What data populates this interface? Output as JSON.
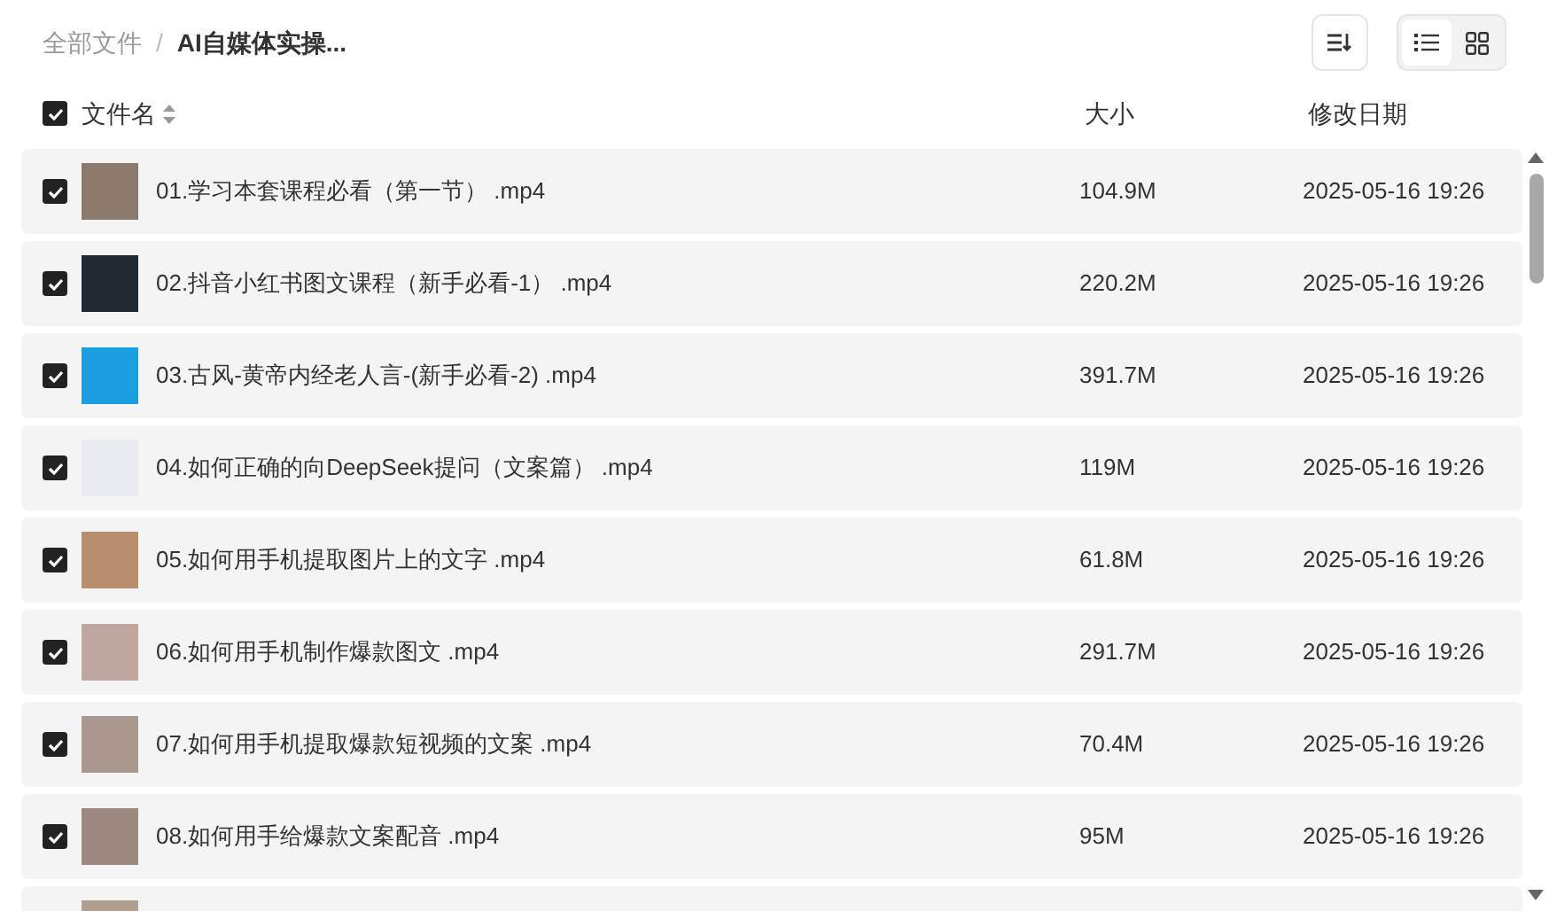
{
  "breadcrumb": {
    "root": "全部文件",
    "separator": "/",
    "current": "AI自媒体实操..."
  },
  "view_modes": [
    {
      "kind": "list",
      "selected": true
    },
    {
      "kind": "grid",
      "selected": false
    }
  ],
  "header": {
    "checked": true,
    "columns": [
      "文件名",
      "大小",
      "修改日期"
    ]
  },
  "rows": [
    {
      "checked": true,
      "name": "01.学习本套课程必看（第一节） .mp4",
      "size": "104.9M",
      "date": "2025-05-16 19:26"
    },
    {
      "checked": true,
      "name": "02.抖音小红书图文课程（新手必看-1） .mp4",
      "size": "220.2M",
      "date": "2025-05-16 19:26"
    },
    {
      "checked": true,
      "name": "03.古风-黄帝内经老人言-(新手必看-2) .mp4",
      "size": "391.7M",
      "date": "2025-05-16 19:26"
    },
    {
      "checked": true,
      "name": "04.如何正确的向DeepSeek提问（文案篇） .mp4",
      "size": "119M",
      "date": "2025-05-16 19:26"
    },
    {
      "checked": true,
      "name": "05.如何用手机提取图片上的文字 .mp4",
      "size": "61.8M",
      "date": "2025-05-16 19:26"
    },
    {
      "checked": true,
      "name": "06.如何用手机制作爆款图文 .mp4",
      "size": "291.7M",
      "date": "2025-05-16 19:26"
    },
    {
      "checked": true,
      "name": "07.如何用手机提取爆款短视频的文案 .mp4",
      "size": "70.4M",
      "date": "2025-05-16 19:26"
    },
    {
      "checked": true,
      "name": "08.如何用手给爆款文案配音 .mp4",
      "size": "95M",
      "date": "2025-05-16 19:26"
    },
    {}
  ]
}
